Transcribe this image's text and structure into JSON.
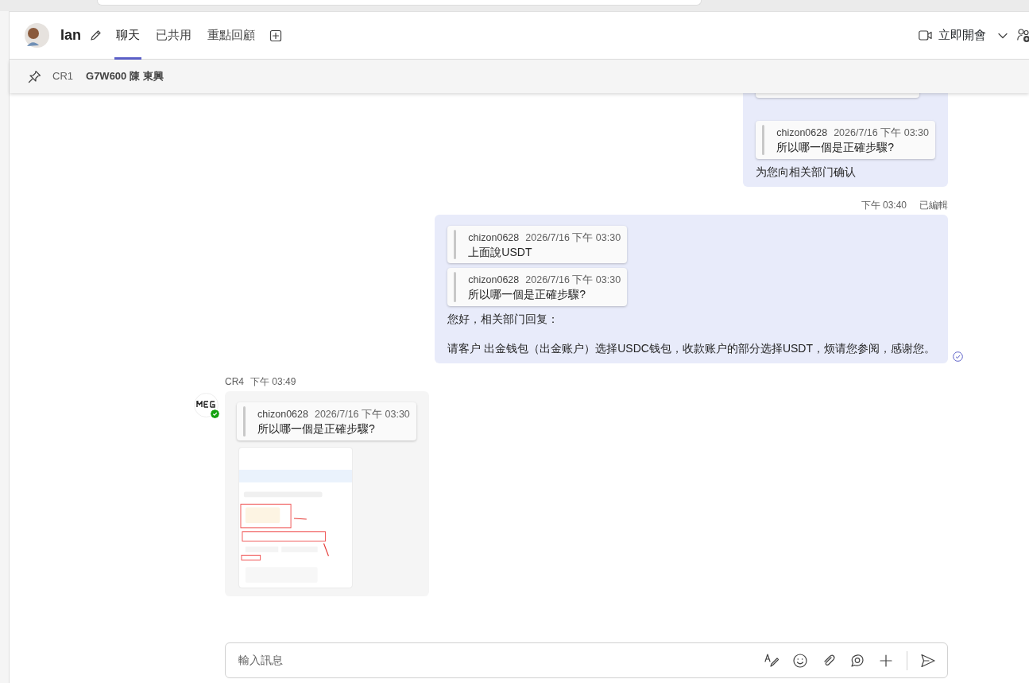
{
  "header": {
    "title": "Ian",
    "tabs": [
      {
        "label": "聊天",
        "selected": true
      },
      {
        "label": "已共用",
        "selected": false
      },
      {
        "label": "重點回顧",
        "selected": false
      }
    ],
    "meet_button": "立即開會"
  },
  "pinned_bar": {
    "items": [
      "CR1",
      "G7W600 陳 東興"
    ]
  },
  "messages": [
    {
      "kind": "sent",
      "hidden_quote_above": true,
      "quotes": [
        {
          "author": "chizon0628",
          "time": "2026/7/16 下午 03:30",
          "text": "所以哪一個是正確步驟?"
        }
      ],
      "paragraphs": [
        "为您向相关部门确认"
      ]
    },
    {
      "kind": "sent",
      "time": "下午 03:40",
      "edited": "已編輯",
      "read": true,
      "quotes": [
        {
          "author": "chizon0628",
          "time": "2026/7/16 下午 03:30",
          "text": "上面說USDT"
        },
        {
          "author": "chizon0628",
          "time": "2026/7/16 下午 03:30",
          "text": "所以哪一個是正確步驟?"
        }
      ],
      "paragraphs": [
        "您好，相关部门回复：",
        "请客户 出金钱包（出金账户）选择USDC钱包，收款账户的部分选择USDT，烦请您参阅，感谢您。"
      ]
    },
    {
      "kind": "received",
      "author": "CR4",
      "time": "下午 03:49",
      "online": true,
      "quotes": [
        {
          "author": "chizon0628",
          "time": "2026/7/16 下午 03:30",
          "text": "所以哪一個是正確步驟?"
        }
      ],
      "attachment": {
        "kind": "picture"
      }
    }
  ],
  "compose": {
    "placeholder": "輸入訊息"
  }
}
